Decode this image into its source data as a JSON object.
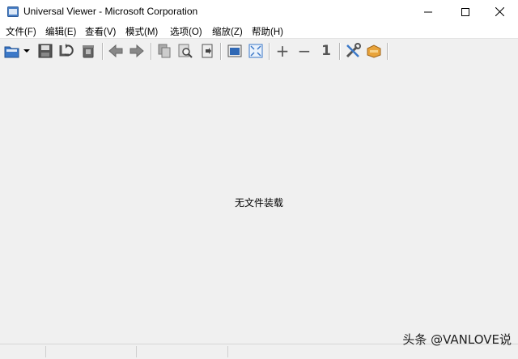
{
  "window": {
    "title": "Universal Viewer - Microsoft Corporation"
  },
  "menu": {
    "items": [
      "文件(F)",
      "编辑(E)",
      "查看(V)",
      "模式(M)",
      "选项(O)",
      "缩放(Z)",
      "帮助(H)"
    ]
  },
  "toolbar": {
    "zoom_in_label": "+",
    "zoom_out_label": "−",
    "original_size_label": "1"
  },
  "main": {
    "empty_message": "无文件装载"
  },
  "watermark": {
    "text": "头条 @VANLOVE说"
  },
  "colors": {
    "window_bg": "#f0f0f0",
    "titlebar_bg": "#ffffff",
    "icon_blue": "#3b78c8"
  }
}
